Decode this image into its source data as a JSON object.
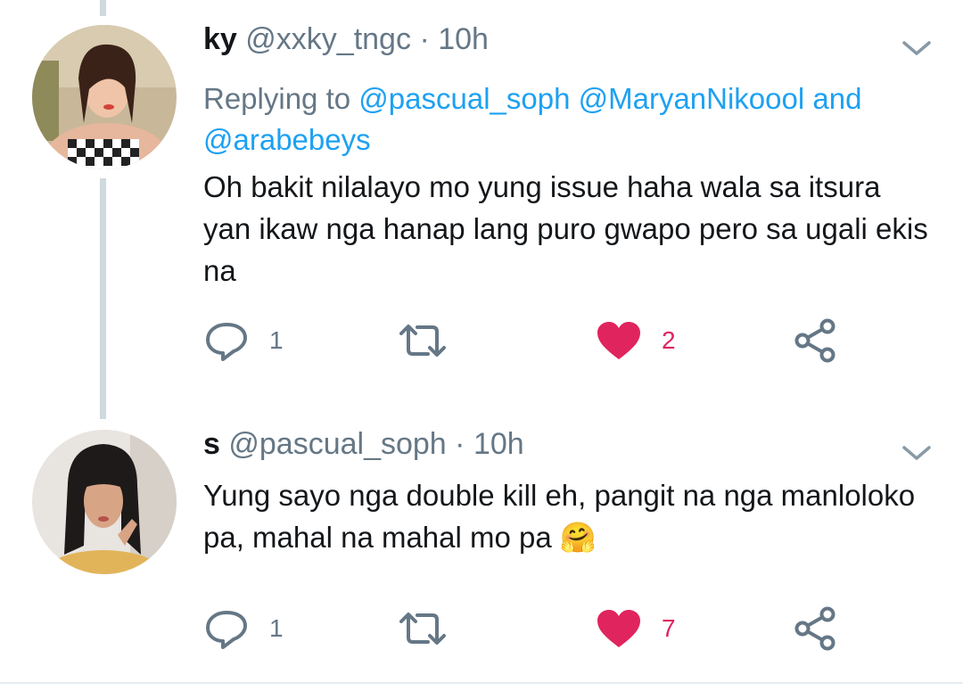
{
  "tweets": [
    {
      "name": "ky",
      "handle": "@xxky_tngc",
      "separator": "·",
      "time": "10h",
      "reply_prefix": "Replying to",
      "reply_mentions": [
        "@pascual_soph",
        "@MaryanNikoool"
      ],
      "reply_and": "and",
      "reply_last": "@arabebeys",
      "text": "Oh bakit nilalayo mo yung issue haha wala sa itsura yan ikaw nga hanap lang puro gwapo pero sa ugali ekis na",
      "actions": {
        "reply_count": "1",
        "retweet_count": "",
        "like_count": "2",
        "liked": true
      }
    },
    {
      "name": "s",
      "handle": "@pascual_soph",
      "separator": "·",
      "time": "10h",
      "text": "Yung sayo nga double kill eh, pangit na nga manloloko pa, mahal na mahal mo pa",
      "emoji": "🤗",
      "actions": {
        "reply_count": "1",
        "retweet_count": "",
        "like_count": "7",
        "liked": true
      }
    }
  ],
  "icons": [
    "reply-icon",
    "retweet-icon",
    "heart-icon",
    "share-icon",
    "chevron-down-icon"
  ],
  "colors": {
    "mention": "#1da1f2",
    "muted": "#657786",
    "like": "#e0245e",
    "thread": "#cfd9de"
  }
}
